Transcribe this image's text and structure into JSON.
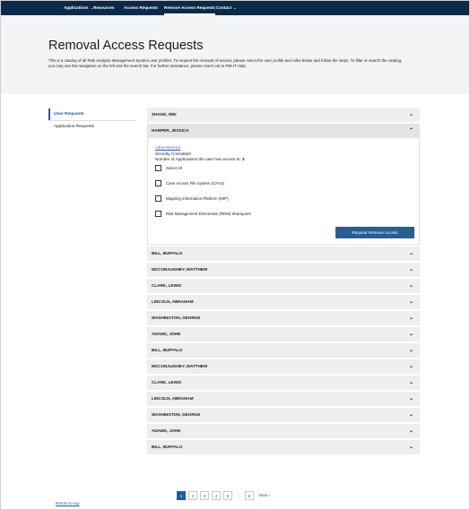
{
  "nav": {
    "items": [
      {
        "label": "Applications",
        "caret": "⌄"
      },
      {
        "label": "Resources",
        "caret": ""
      },
      {
        "label": "Access Requests",
        "caret": ""
      },
      {
        "label": "Remove Access Requests",
        "caret": "",
        "active": true
      },
      {
        "label": "Contact",
        "caret": "⌄"
      }
    ]
  },
  "header": {
    "title": "Removal Access Requests",
    "intro": "This is a catalog of all Risk Analysis Management System user profiles.  To request the removal of access, please select the user profile and roles below and follow the steps. To filter or search the catalog, you may use the navigation on the left and the search bar. For further assistance, please reach out to RM-IT Help."
  },
  "sidebar": {
    "items": [
      {
        "label": "User Requests",
        "active": true
      },
      {
        "label": "Application Requests",
        "active": false
      }
    ]
  },
  "users": {
    "first": {
      "name": "ZHANG, WEI",
      "chevron": "⌄"
    },
    "open": {
      "name": "HARPER, JESSICA",
      "chevron": "⌃",
      "view_profile": "VIEW PROFILE",
      "job_title": "Security Consultant",
      "app_count_label": "Number of Applications the user has access to:",
      "app_count": "3",
      "select_all": "Select All",
      "apps": [
        "Case Access File System (CFAS)",
        "Mapping Information Platform (MIP)",
        "Risk Management Directorate (RDM) Sharepoint"
      ],
      "request_button": "Request Remove Access"
    },
    "rest": [
      "BILL, BUFFALO",
      "MCCONAUGHEY, MATTHEW",
      "CLARK, LEWIS",
      "LINCOLN, ABRAHAM",
      "WASHINGTON, GEORGE",
      "ADAMS, JOHN",
      "BILL, BUFFALO",
      "MCCONAUGHEY, MATTHEW",
      "CLARK, LEWIS",
      "LINCOLN, ABRAHAM",
      "WASHINGTON, GEORGE",
      "ADAMS, JOHN",
      "BILL, BUFFALO"
    ],
    "chevron": "⌄"
  },
  "pagination": {
    "pages": [
      "1",
      "2",
      "3",
      "4",
      "5"
    ],
    "ellipsis": "…",
    "last": "8",
    "next": "Next ›",
    "current": "1"
  },
  "footer": {
    "return_to_top": "Return to top"
  },
  "colors": {
    "nav_bg": "#0b2a4a",
    "accent": "#1f5aa6",
    "button": "#2a5d92",
    "header_bg": "#f3f4f6"
  }
}
